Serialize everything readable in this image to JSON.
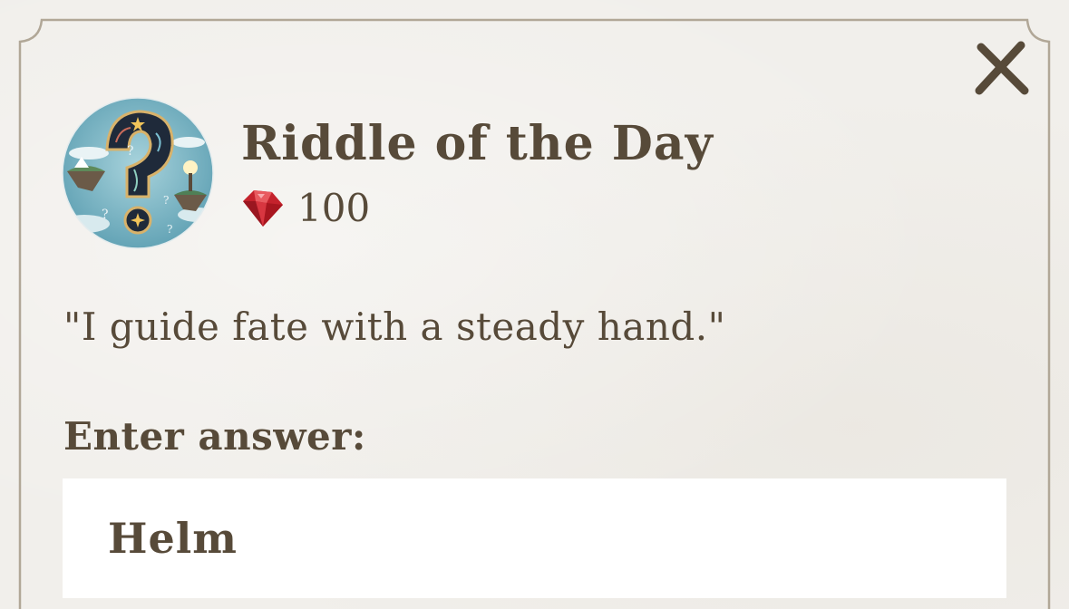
{
  "dialog": {
    "title": "Riddle of the Day",
    "reward": {
      "icon": "ruby-gem-icon",
      "amount": "100"
    },
    "riddle_text": "\"I guide fate with a steady hand.\"",
    "answer_label": "Enter answer:",
    "answer_input": {
      "value": "Helm",
      "placeholder": ""
    },
    "close_icon": "close-x-icon",
    "avatar_icon": "question-mark-fantasy-icon"
  },
  "colors": {
    "background": "#f1efeb",
    "frame_border": "#b1a797",
    "text": "#574a39",
    "input_background": "#ffffff",
    "ruby": "#c4222c",
    "avatar_background": "#7fb8c6"
  }
}
